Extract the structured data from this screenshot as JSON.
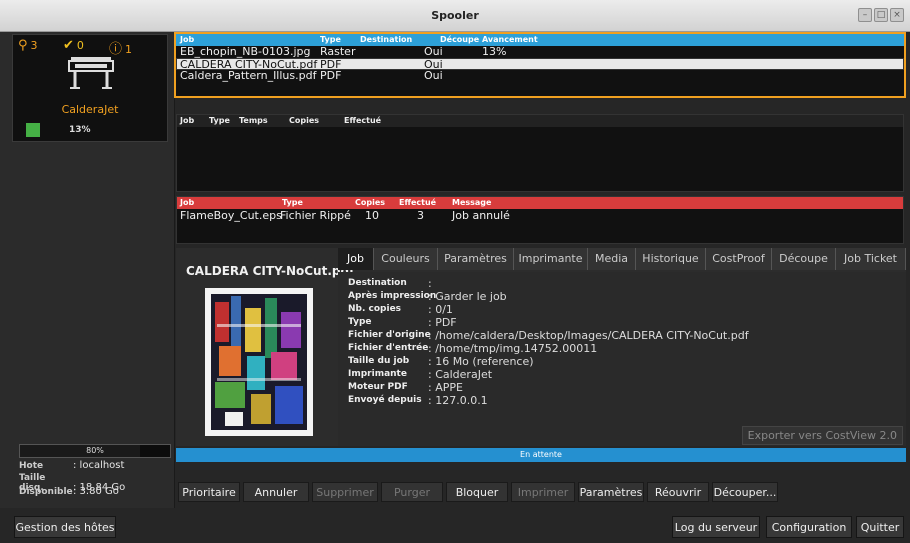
{
  "window": {
    "title": "Spooler"
  },
  "printer": {
    "queued": "3",
    "done": "0",
    "errors": "1",
    "name": "CalderaJet",
    "progress": "13%"
  },
  "host": {
    "disk_percent": "80%",
    "rows": [
      {
        "label": "Hote",
        "value": ": localhost"
      },
      {
        "label": "Taille disq.",
        "value": ": 18.84 Go"
      },
      {
        "label": "Disponible",
        "value": ": 3.80 Go"
      }
    ]
  },
  "active_queue": {
    "headers": [
      "Job",
      "Type",
      "Destination",
      "Découpe",
      "Avancement"
    ],
    "rows": [
      {
        "job": "EB_chopin_NB-0103.jpg",
        "type": "Raster",
        "destination": "",
        "decoupe": "Oui",
        "avancement": "13%"
      },
      {
        "job": "CALDERA CITY-NoCut.pdf",
        "type": "PDF",
        "destination": "",
        "decoupe": "Oui",
        "avancement": ""
      },
      {
        "job": "Caldera_Pattern_Illus.pdf",
        "type": "PDF",
        "destination": "",
        "decoupe": "Oui",
        "avancement": ""
      }
    ]
  },
  "done_queue": {
    "headers": [
      "Job",
      "Type",
      "Temps",
      "Copies",
      "Effectué"
    ]
  },
  "error_queue": {
    "headers": [
      "Job",
      "Type",
      "Copies",
      "Effectué",
      "Message"
    ],
    "rows": [
      {
        "job": "FlameBoy_Cut.eps",
        "type": "Fichier Rippé",
        "copies": "10",
        "effectue": "3",
        "message": "Job annulé"
      }
    ]
  },
  "details": {
    "job_title": "CALDERA CITY-NoCut.pdf",
    "tabs": [
      "Job",
      "Couleurs",
      "Paramètres",
      "Imprimante",
      "Media",
      "Historique",
      "CostProof",
      "Découpe",
      "Job Ticket"
    ],
    "active_tab": "Job",
    "info": [
      {
        "label": "Destination",
        "value": ":"
      },
      {
        "label": "Après impression",
        "value": ": Garder le job"
      },
      {
        "label": "Nb. copies",
        "value": ": 0/1"
      },
      {
        "label": "Type",
        "value": ": PDF"
      },
      {
        "label": "Fichier d'origine",
        "value": ": /home/caldera/Desktop/Images/CALDERA CITY-NoCut.pdf"
      },
      {
        "label": "Fichier d'entrée",
        "value": ": /home/tmp/img.14752.00011"
      },
      {
        "label": "Taille du job",
        "value": ": 16 Mo (reference)"
      },
      {
        "label": "Imprimante",
        "value": ": CalderaJet"
      },
      {
        "label": "Moteur PDF",
        "value": ": APPE"
      },
      {
        "label": "Envoyé depuis",
        "value": ": 127.0.0.1"
      }
    ],
    "export_label": "Exporter vers CostView 2.0"
  },
  "status": {
    "text": "En attente"
  },
  "actions": [
    "Prioritaire",
    "Annuler",
    "Supprimer",
    "Purger",
    "Bloquer",
    "Imprimer",
    "Paramètres",
    "Réouvrir",
    "Découper..."
  ],
  "bottom": {
    "hosts": "Gestion des hôtes",
    "log": "Log du serveur",
    "config": "Configuration",
    "quit": "Quitter"
  },
  "colors": {
    "accent_orange": "#f0a020",
    "active_header": "#2da0d8",
    "error_header": "#d83c3c",
    "status_blue": "#2590d0",
    "progress_green": "#45b045"
  }
}
